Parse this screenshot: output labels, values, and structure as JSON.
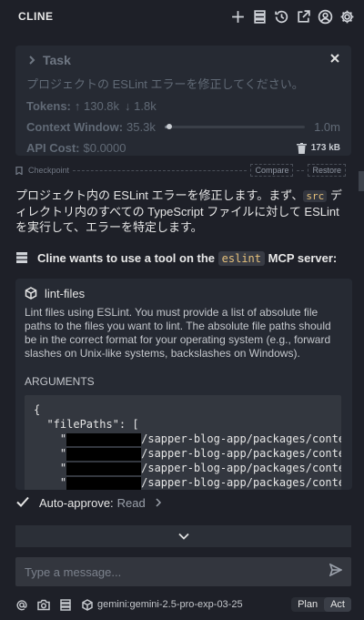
{
  "header": {
    "title": "CLINE",
    "icons": [
      "plus-icon",
      "server-icon",
      "history-icon",
      "popout-icon",
      "account-icon",
      "gear-icon"
    ]
  },
  "task": {
    "label": "Task",
    "text": "プロジェクトの ESLint エラーを修正してください。",
    "tokens_label": "Tokens:",
    "tokens_in": "↑ 130.8k",
    "tokens_out": "↓ 1.8k",
    "context_label": "Context Window:",
    "context_used": "35.3k",
    "context_max": "1.0m",
    "context_fraction": 0.035,
    "cost_label": "API Cost:",
    "cost_value": "$0.0000",
    "size": "173 kB"
  },
  "checkpoint": {
    "label": "Checkpoint",
    "compare": "Compare",
    "restore": "Restore"
  },
  "message": {
    "part1": "プロジェクト内の ESLint エラーを修正します。まず、",
    "chip": "src",
    "part2": " ディレクトリ内のすべての TypeScript ファイルに対して ESLint を実行して、エラーを特定します。"
  },
  "tool_request": {
    "prefix": "Cline wants to use a tool on the",
    "server": "eslint",
    "suffix": "MCP server:"
  },
  "tool": {
    "name": "lint-files",
    "description": "Lint files using ESLint. You must provide a list of absolute file paths to the files you want to lint. The absolute file paths should be in the correct format for your operating system (e.g., forward slashes on Unix-like systems, backslashes on Windows).",
    "args_label": "ARGUMENTS",
    "code_line1": "{",
    "code_line2": "  \"filePaths\": [",
    "path_prefix": "    \"",
    "path_suffix": "/sapper-blog-app/packages/conte"
  },
  "auto_approve": {
    "label": "Auto-approve:",
    "value": "Read"
  },
  "input": {
    "placeholder": "Type a message..."
  },
  "bottom": {
    "model": "gemini:gemini-2.5-pro-exp-03-25",
    "plan": "Plan",
    "act": "Act"
  }
}
